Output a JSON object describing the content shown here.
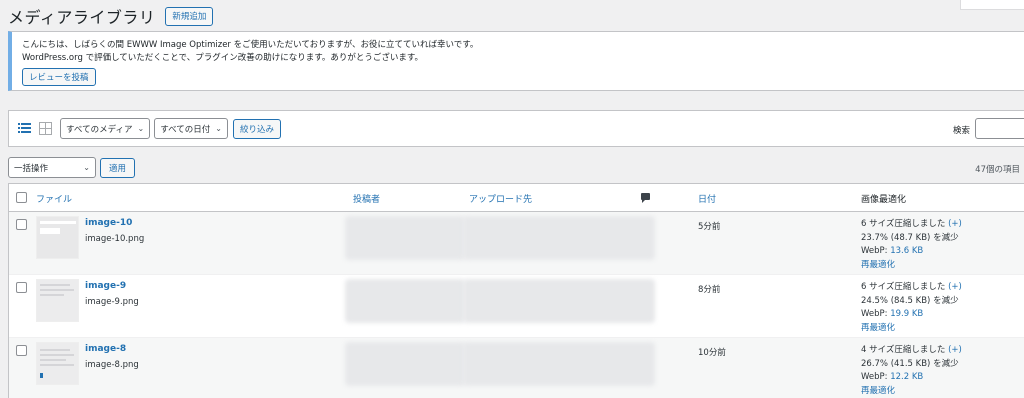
{
  "header": {
    "page_title": "メディアライブラリ",
    "add_new_label": "新規追加"
  },
  "notice": {
    "line1": "こんにちは、しばらくの間 EWWW Image Optimizer をご使用いただいておりますが、お役に立てていれば幸いです。",
    "line2": "WordPress.org で評価していただくことで、プラグイン改善の助けになります。ありがとうございます。",
    "review_button": "レビューを投稿"
  },
  "filters": {
    "media_type": "すべてのメディア",
    "date": "すべての日付",
    "filter_button": "絞り込み",
    "search_label": "検索"
  },
  "bulk": {
    "action": "一括操作",
    "apply": "適用",
    "items_count": "47個の項目"
  },
  "columns": {
    "file": "ファイル",
    "author": "投稿者",
    "uploaded_to": "アップロード先",
    "date": "日付",
    "optimization": "画像最適化"
  },
  "rows": [
    {
      "title": "image-10",
      "filename": "image-10.png",
      "date": "5分前",
      "opt_summary": "6 サイズ圧縮しました",
      "opt_plus": "(+)",
      "opt_reduced": "23.7% (48.7 KB) を減少",
      "webp_label": "WebP:",
      "webp_size": "13.6 KB",
      "reoptimize": "再最適化"
    },
    {
      "title": "image-9",
      "filename": "image-9.png",
      "date": "8分前",
      "opt_summary": "6 サイズ圧縮しました",
      "opt_plus": "(+)",
      "opt_reduced": "24.5% (84.5 KB) を減少",
      "webp_label": "WebP:",
      "webp_size": "19.9 KB",
      "reoptimize": "再最適化"
    },
    {
      "title": "image-8",
      "filename": "image-8.png",
      "date": "10分前",
      "opt_summary": "4 サイズ圧縮しました",
      "opt_plus": "(+)",
      "opt_reduced": "26.7% (41.5 KB) を減少",
      "webp_label": "WebP:",
      "webp_size": "12.2 KB",
      "reoptimize": "再最適化"
    }
  ],
  "icons": {
    "list_view": "list-view-icon",
    "grid_view": "grid-view-icon",
    "comment": "comment-icon",
    "chevron": "chevron-down-icon"
  },
  "colors": {
    "accent": "#2271b1",
    "notice_border": "#72aee6",
    "background": "#f0f0f1"
  }
}
